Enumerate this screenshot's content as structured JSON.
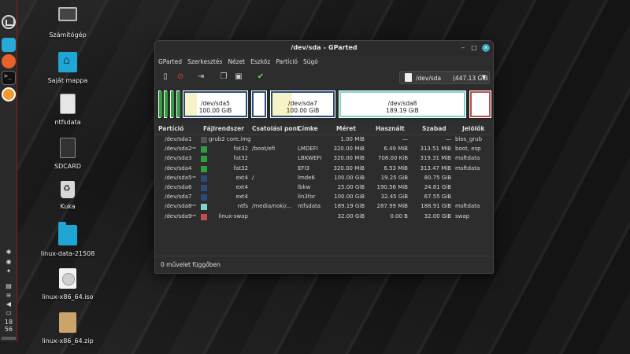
{
  "desktop": {
    "icons": [
      {
        "label": "Számítógép",
        "icon": "computer-icon"
      },
      {
        "label": "Saját mappa",
        "icon": "home-folder-icon"
      },
      {
        "label": "ntfsdata",
        "icon": "drive-icon"
      },
      {
        "label": "SDCARD",
        "icon": "sdcard-icon"
      },
      {
        "label": "Kuka",
        "icon": "trash-icon"
      },
      {
        "label": "linux-data-21508",
        "icon": "folder-icon"
      },
      {
        "label": "linux-x86_64.iso",
        "icon": "disc-image-icon"
      },
      {
        "label": "linux-x86_64.zip",
        "icon": "archive-icon"
      }
    ]
  },
  "panel": {
    "clock_hour": "18",
    "clock_minute": "56"
  },
  "window": {
    "title": "/dev/sda – GParted",
    "menu": [
      "GParted",
      "Szerkesztés",
      "Nézet",
      "Eszköz",
      "Partíció",
      "Súgó"
    ],
    "device": {
      "name": "/dev/sda",
      "size": "(447.13 GiB"
    },
    "graph": [
      {
        "name": "/dev/sda5",
        "size": "100.00 GiB",
        "used_fraction": 0.19,
        "color": "#2a4b7c"
      },
      {
        "name": "/dev/sda7",
        "size": "100.00 GiB",
        "used_fraction": 0.32,
        "color": "#2a4b7c"
      },
      {
        "name": "/dev/sda8",
        "size": "189.19 GiB",
        "used_fraction": 0.0,
        "color": "#7fd4c6"
      }
    ],
    "columns": [
      "Partíció",
      "Fájlrendszer",
      "Csatolási pont",
      "Címke",
      "Méret",
      "Használt",
      "Szabad",
      "Jelölők"
    ],
    "rows": [
      {
        "partition": "/dev/sda1",
        "key": false,
        "fs": "grub2 core.img",
        "fs_color": "#555555",
        "mount": "",
        "label": "",
        "size": "1.00 MiB",
        "used": "—",
        "free": "—",
        "flags": "bios_grub"
      },
      {
        "partition": "/dev/sda2",
        "key": true,
        "fs": "fat32",
        "fs_color": "#2e9e3e",
        "mount": "/boot/efi",
        "label": "LMDEFI",
        "size": "320.00 MiB",
        "used": "6.49 MiB",
        "free": "313.51 MiB",
        "flags": "boot, esp"
      },
      {
        "partition": "/dev/sda3",
        "key": false,
        "fs": "fat32",
        "fs_color": "#2e9e3e",
        "mount": "",
        "label": "LBKWEFI",
        "size": "320.00 MiB",
        "used": "708.00 KiB",
        "free": "319.31 MiB",
        "flags": "msftdata"
      },
      {
        "partition": "/dev/sda4",
        "key": false,
        "fs": "fat32",
        "fs_color": "#2e9e3e",
        "mount": "",
        "label": "EFI3",
        "size": "320.00 MiB",
        "used": "6.53 MiB",
        "free": "313.47 MiB",
        "flags": "msftdata"
      },
      {
        "partition": "/dev/sda5",
        "key": true,
        "fs": "ext4",
        "fs_color": "#2a4b7c",
        "mount": "/",
        "label": "lmde6",
        "size": "100.00 GiB",
        "used": "19.25 GiB",
        "free": "80.75 GiB",
        "flags": ""
      },
      {
        "partition": "/dev/sda6",
        "key": false,
        "fs": "ext4",
        "fs_color": "#2a4b7c",
        "mount": "",
        "label": "lbkw",
        "size": "25.00 GiB",
        "used": "190.56 MiB",
        "free": "24.81 GiB",
        "flags": ""
      },
      {
        "partition": "/dev/sda7",
        "key": false,
        "fs": "ext4",
        "fs_color": "#2a4b7c",
        "mount": "",
        "label": "lin3for",
        "size": "100.00 GiB",
        "used": "32.45 GiB",
        "free": "67.55 GiB",
        "flags": ""
      },
      {
        "partition": "/dev/sda8",
        "key": true,
        "fs": "ntfs",
        "fs_color": "#7fd4c6",
        "mount": "/media/noki/...",
        "label": "ntfsdata",
        "size": "189.19 GiB",
        "used": "287.99 MiB",
        "free": "188.91 GiB",
        "flags": "msftdata"
      },
      {
        "partition": "/dev/sda9",
        "key": true,
        "fs": "linux-swap",
        "fs_color": "#c0504d",
        "mount": "",
        "label": "",
        "size": "32.00 GiB",
        "used": "0.00 B",
        "free": "32.00 GiB",
        "flags": "swap"
      }
    ],
    "status": "0 művelet függőben"
  }
}
